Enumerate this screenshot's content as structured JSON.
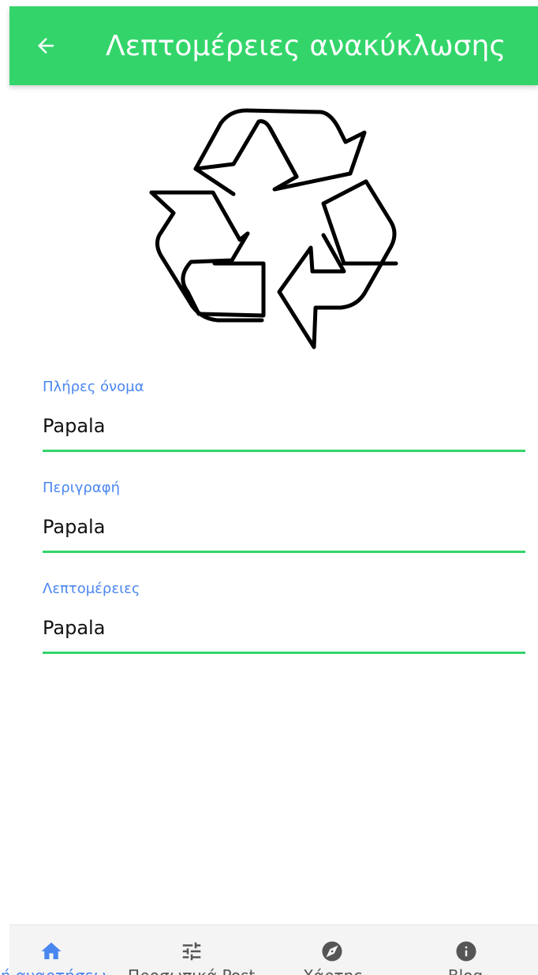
{
  "appbar": {
    "title": "Λεπτομέρειες ανακύκλωσης",
    "back_icon": "arrow-left-icon",
    "background": "#33d56a"
  },
  "image": {
    "icon": "recycle-icon"
  },
  "fields": [
    {
      "label": "Πλήρες όνομα",
      "value": "Papala"
    },
    {
      "label": "Περιγραφή",
      "value": "Papala"
    },
    {
      "label": "Λεπτομέρειες",
      "value": "Papala"
    }
  ],
  "bottom_nav": {
    "active_color": "#4a86f0",
    "inactive_color": "#555555",
    "items": [
      {
        "label": "ή αναρτήσεω",
        "icon": "home-icon",
        "active": true
      },
      {
        "label": "Προσωπικά Post",
        "icon": "sliders-icon",
        "active": false
      },
      {
        "label": "Χάρτης",
        "icon": "compass-icon",
        "active": false
      },
      {
        "label": "Blog",
        "icon": "info-icon",
        "active": false
      }
    ]
  }
}
